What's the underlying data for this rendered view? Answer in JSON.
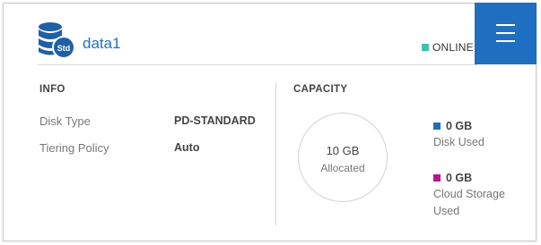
{
  "volume": {
    "name": "data1",
    "badge": "Std",
    "icon": "database-icon",
    "status": "ONLINE",
    "status_color": "#3dc3a6"
  },
  "menu": {
    "icon": "hamburger-menu-icon",
    "color": "#1f6fc0"
  },
  "info": {
    "title": "INFO",
    "rows": [
      {
        "label": "Disk Type",
        "value": "PD-STANDARD"
      },
      {
        "label": "Tiering Policy",
        "value": "Auto"
      }
    ]
  },
  "capacity": {
    "title": "CAPACITY",
    "allocated_value": "10 GB",
    "allocated_label": "Allocated",
    "legend": [
      {
        "value": "0 GB",
        "label_line1": "Disk Used",
        "label_line2": "",
        "color": "#1f6fc0"
      },
      {
        "value": "0 GB",
        "label_line1": "Cloud Storage",
        "label_line2": "Used",
        "color": "#b5168f"
      }
    ]
  }
}
